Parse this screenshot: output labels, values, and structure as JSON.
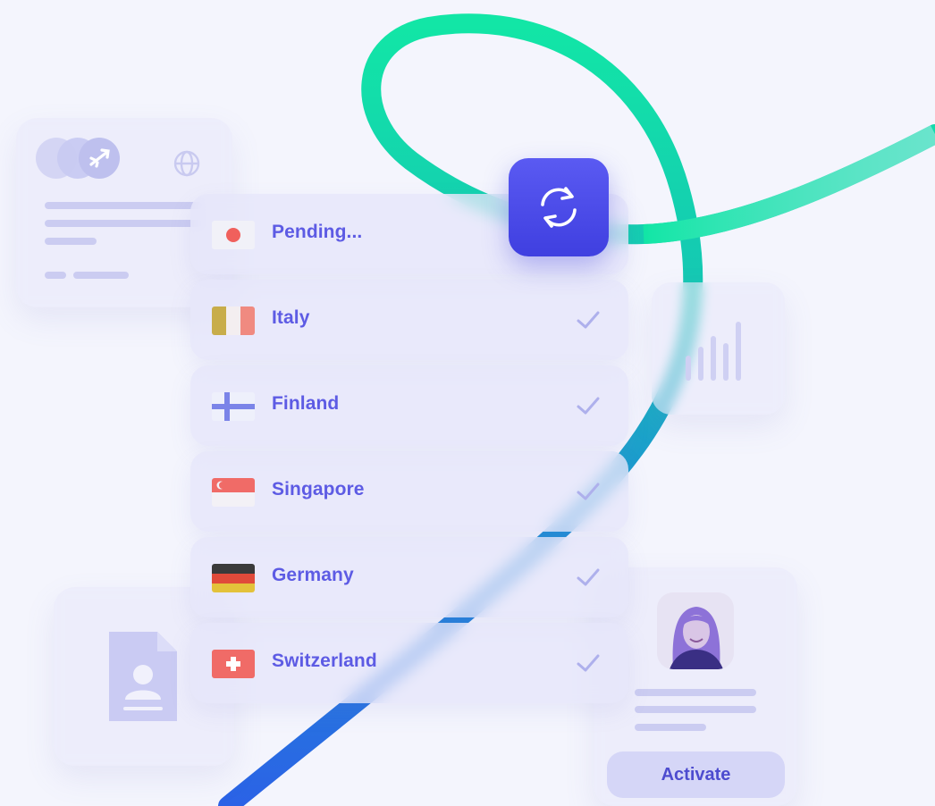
{
  "countries": [
    {
      "label": "Pending...",
      "flag": "japan-flag-icon",
      "status": "pending"
    },
    {
      "label": "Italy",
      "flag": "italy-flag-icon",
      "status": "done"
    },
    {
      "label": "Finland",
      "flag": "finland-flag-icon",
      "status": "done"
    },
    {
      "label": "Singapore",
      "flag": "singapore-flag-icon",
      "status": "done"
    },
    {
      "label": "Germany",
      "flag": "germany-flag-icon",
      "status": "done"
    },
    {
      "label": "Switzerland",
      "flag": "switzerland-flag-icon",
      "status": "done"
    }
  ],
  "profile_card": {
    "activate_label": "Activate"
  },
  "icons": {
    "sync": "sync-icon",
    "check": "check-icon",
    "globe": "globe-icon",
    "airplane": "airplane-icon",
    "chart": "bar-chart-icon",
    "document": "id-document-icon"
  },
  "colors": {
    "accent": "#5d5be4",
    "button": "#4848e8",
    "ribbon_start": "#0fe4a4",
    "ribbon_end": "#2a64e6",
    "background": "#f4f5fd"
  }
}
